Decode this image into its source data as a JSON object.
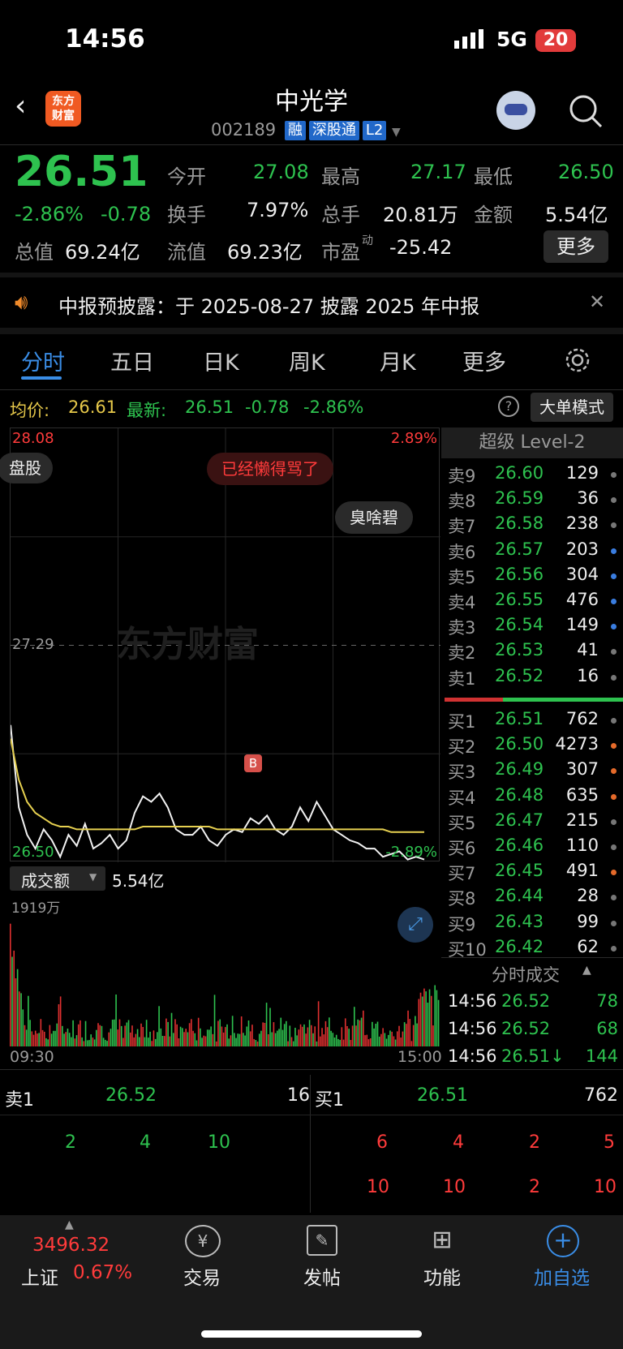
{
  "status": {
    "time": "14:56",
    "network": "5G",
    "battery": "20"
  },
  "header": {
    "title": "中光学",
    "code": "002189",
    "tags": [
      "融",
      "深股通",
      "L2"
    ],
    "logo_line1": "东方",
    "logo_line2": "财富"
  },
  "quote": {
    "price": "26.51",
    "change_pct": "-2.86%",
    "change": "-0.78",
    "open_label": "今开",
    "open": "27.08",
    "high_label": "最高",
    "high": "27.17",
    "low_label": "最低",
    "low": "26.50",
    "turnover_label": "换手",
    "turnover": "7.97%",
    "volume_label": "总手",
    "volume": "20.81万",
    "amount_label": "金额",
    "amount": "5.54亿",
    "mktcap_label": "总值",
    "mktcap": "69.24亿",
    "float_label": "流值",
    "float_cap": "69.23亿",
    "pe_label": "市盈",
    "pe_sup": "动",
    "pe": "-25.42",
    "more": "更多"
  },
  "notice": {
    "text": "中报预披露：于 2025-08-27 披露 2025 年中报"
  },
  "tabs": [
    "分时",
    "五日",
    "日K",
    "周K",
    "月K",
    "更多"
  ],
  "info_bar": {
    "avg_label": "均价:",
    "avg": "26.61",
    "last_label": "最新:",
    "last": "26.51",
    "chg": "-0.78",
    "chg_pct": "-2.86%",
    "mode": "大单模式"
  },
  "chart": {
    "top_price": "28.08",
    "top_pct": "2.89%",
    "mid_price": "27.29",
    "bottom_price": "26.50",
    "bottom_pct": "-2.89%",
    "bubble1": "已经懒得骂了",
    "bubble2": "臭啥碧",
    "bubble3": "盘股",
    "watermark": "东方财富",
    "marker": "B",
    "time_start": "09:30",
    "time_end": "15:00"
  },
  "chart_data": {
    "type": "line",
    "series": [
      {
        "name": "",
        "values": [
          27.0,
          26.7,
          26.6,
          26.55,
          26.62,
          26.58,
          26.52,
          26.6,
          26.56,
          26.64,
          26.55,
          26.57,
          26.6,
          26.55,
          26.58,
          26.68,
          26.74,
          26.72,
          26.75,
          26.7,
          26.62,
          26.6,
          26.6,
          26.63,
          26.58,
          26.56,
          26.6,
          26.62,
          26.61,
          26.66,
          26.64,
          26.67,
          26.62,
          26.6,
          26.63,
          26.7,
          26.65,
          26.72,
          26.67,
          26.62,
          26.6,
          26.58,
          26.57,
          26.55,
          26.55,
          26.52,
          26.53,
          26.54,
          26.51,
          26.52,
          26.51
        ]
      },
      {
        "name": "",
        "values": [
          26.95,
          26.8,
          26.72,
          26.68,
          26.66,
          26.64,
          26.63,
          26.63,
          26.62,
          26.62,
          26.62,
          26.62,
          26.62,
          26.62,
          26.62,
          26.62,
          26.63,
          26.63,
          26.63,
          26.63,
          26.63,
          26.63,
          26.63,
          26.63,
          26.63,
          26.62,
          26.62,
          26.62,
          26.62,
          26.62,
          26.62,
          26.62,
          26.62,
          26.62,
          26.62,
          26.62,
          26.62,
          26.62,
          26.62,
          26.62,
          26.62,
          26.62,
          26.62,
          26.62,
          26.62,
          26.62,
          26.61,
          26.61,
          26.61,
          26.61,
          26.61
        ]
      }
    ],
    "ylim": [
      26.5,
      28.08
    ]
  },
  "volume": {
    "label": "成交额",
    "value": "5.54亿",
    "max": "1919万"
  },
  "level2": {
    "title": "超级 Level-2",
    "asks": [
      {
        "l": "卖9",
        "p": "26.60",
        "q": "129",
        "c": "#777"
      },
      {
        "l": "卖8",
        "p": "26.59",
        "q": "36",
        "c": "#777"
      },
      {
        "l": "卖7",
        "p": "26.58",
        "q": "238",
        "c": "#777"
      },
      {
        "l": "卖6",
        "p": "26.57",
        "q": "203",
        "c": "#3a7de0"
      },
      {
        "l": "卖5",
        "p": "26.56",
        "q": "304",
        "c": "#3a7de0"
      },
      {
        "l": "卖4",
        "p": "26.55",
        "q": "476",
        "c": "#3a7de0"
      },
      {
        "l": "卖3",
        "p": "26.54",
        "q": "149",
        "c": "#3a7de0"
      },
      {
        "l": "卖2",
        "p": "26.53",
        "q": "41",
        "c": "#777"
      },
      {
        "l": "卖1",
        "p": "26.52",
        "q": "16",
        "c": "#777"
      }
    ],
    "bids": [
      {
        "l": "买1",
        "p": "26.51",
        "q": "762",
        "c": "#777"
      },
      {
        "l": "买2",
        "p": "26.50",
        "q": "4273",
        "c": "#e56a2a"
      },
      {
        "l": "买3",
        "p": "26.49",
        "q": "307",
        "c": "#e56a2a"
      },
      {
        "l": "买4",
        "p": "26.48",
        "q": "635",
        "c": "#e56a2a"
      },
      {
        "l": "买5",
        "p": "26.47",
        "q": "215",
        "c": "#777"
      },
      {
        "l": "买6",
        "p": "26.46",
        "q": "110",
        "c": "#777"
      },
      {
        "l": "买7",
        "p": "26.45",
        "q": "491",
        "c": "#e56a2a"
      },
      {
        "l": "买8",
        "p": "26.44",
        "q": "28",
        "c": "#777"
      },
      {
        "l": "买9",
        "p": "26.43",
        "q": "99",
        "c": "#777"
      },
      {
        "l": "买10",
        "p": "26.42",
        "q": "62",
        "c": "#777"
      }
    ],
    "ticks_title": "分时成交",
    "ticks": [
      {
        "t": "14:56",
        "p": "26.52",
        "q": "78"
      },
      {
        "t": "14:56",
        "p": "26.52",
        "q": "68"
      },
      {
        "t": "14:56",
        "p": "26.51↓",
        "q": "144"
      }
    ]
  },
  "queue": {
    "ask_label": "卖1",
    "ask_price": "26.52",
    "ask_qty": "16",
    "bid_label": "买1",
    "bid_price": "26.51",
    "bid_qty": "762",
    "ask_orders": [
      "2",
      "4",
      "10"
    ],
    "bid_orders_row1": [
      "6",
      "4",
      "2",
      "5"
    ],
    "bid_orders_row2": [
      "10",
      "10",
      "2",
      "10"
    ]
  },
  "bottom_nav": {
    "index_value": "3496.32",
    "index_name": "上证",
    "index_pct": "0.67%",
    "trade": "交易",
    "post": "发帖",
    "func": "功能",
    "add": "加自选"
  }
}
